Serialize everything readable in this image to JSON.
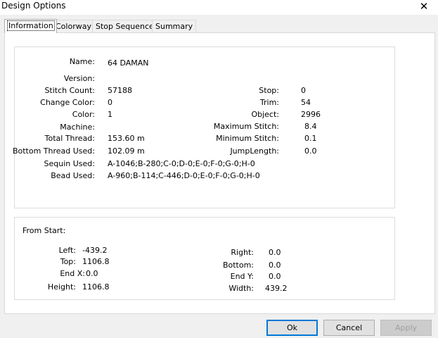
{
  "window": {
    "title": "Design Options",
    "close_glyph": "✕"
  },
  "tabs": [
    {
      "label": "Information",
      "active": true
    },
    {
      "label": "Colorway"
    },
    {
      "label": "Stop Sequence"
    },
    {
      "label": "Summary"
    }
  ],
  "info": {
    "name_label": "Name:",
    "name_value": "64 DAMAN",
    "version_label": "Version:",
    "version_value": "",
    "stitch_count_label": "Stitch Count:",
    "stitch_count_value": "57188",
    "change_color_label": "Change Color:",
    "change_color_value": "0",
    "color_label": "Color:",
    "color_value": "1",
    "machine_label": "Machine:",
    "machine_value": "",
    "total_thread_label": "Total Thread:",
    "total_thread_value": "153.60 m",
    "bottom_thread_label": "Bottom Thread Used:",
    "bottom_thread_value": "102.09 m",
    "sequin_label": "Sequin Used:",
    "sequin_value": "A-1046;B-280;C-0;D-0;E-0;F-0;G-0;H-0",
    "bead_label": "Bead Used:",
    "bead_value": "A-960;B-114;C-446;D-0;E-0;F-0;G-0;H-0",
    "stop_label": "Stop:",
    "stop_value": "0",
    "trim_label": "Trim:",
    "trim_value": "54",
    "object_label": "Object:",
    "object_value": "2996",
    "max_stitch_label": "Maximum Stitch:",
    "max_stitch_value": "8.4",
    "min_stitch_label": "Minimum Stitch:",
    "min_stitch_value": "0.1",
    "jump_length_label": "JumpLength:",
    "jump_length_value": "0.0"
  },
  "from_start": {
    "title": "From Start:",
    "left_label": "Left:",
    "left_value": "-439.2",
    "top_label": "Top:",
    "top_value": "1106.8",
    "endx_label": "End X:",
    "endx_value": "0.0",
    "height_label": "Height:",
    "height_value": "1106.8",
    "right_label": "Right:",
    "right_value": "0.0",
    "bottom_label": "Bottom:",
    "bottom_value": "0.0",
    "endy_label": "End Y:",
    "endy_value": "0.0",
    "width_label": "Width:",
    "width_value": "439.2"
  },
  "buttons": {
    "ok": "Ok",
    "cancel": "Cancel",
    "apply": "Apply"
  }
}
